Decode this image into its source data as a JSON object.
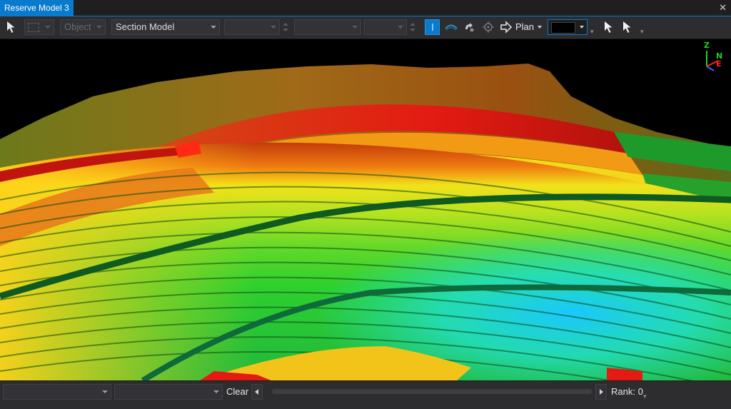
{
  "window": {
    "title": "Reserve Model 3",
    "close_glyph": "✕"
  },
  "toolbar": {
    "object_combo": {
      "value": "Object",
      "disabled": true
    },
    "section_combo": {
      "value": "Section Model"
    },
    "view_label": "Plan",
    "color_swatch": "#000000"
  },
  "viewport": {
    "axis_labels": {
      "z": "Z",
      "n": "N",
      "e": "E"
    },
    "axis_colors": {
      "z": "#1fd11f",
      "n": "#22cc22",
      "e": "#ff2020",
      "x": "#3a6bff"
    }
  },
  "statusbar": {
    "clear_label": "Clear",
    "rank_label": "Rank: 0"
  },
  "colors": {
    "accent": "#0a7acc",
    "background": "#2d2d30"
  }
}
